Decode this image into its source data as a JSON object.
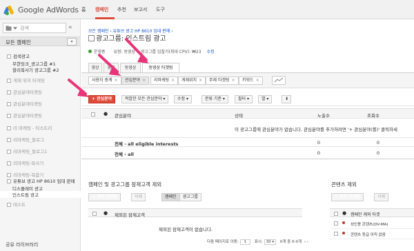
{
  "topbar": {
    "logo_text": "Google AdWords",
    "nav": [
      "홈",
      "캠페인",
      "추천",
      "보고서",
      "도구"
    ],
    "active_nav": "캠페인"
  },
  "sidebar": {
    "search_placeholder": "검색",
    "collapse_glyph": "«",
    "all_campaigns": "모든 캠페인",
    "items": [
      {
        "label": "검색광고",
        "style": "normal"
      },
      {
        "label": "무한잉크_광고그룹 #1",
        "style": "normal"
      },
      {
        "label": "할리복사기 광고그룹 #2",
        "style": "normal"
      },
      {
        "label": "게재 위치 타게팅",
        "style": "grey"
      },
      {
        "label": "관심분야타겟팅",
        "style": "grey"
      },
      {
        "label": "관심분야타겟팅",
        "style": "grey"
      },
      {
        "label": "관심분야타겟팅",
        "style": "grey"
      },
      {
        "label": "리 마케팅 - 타스트리",
        "style": "grey"
      },
      {
        "label": "리마케팅_블로그",
        "style": "grey"
      },
      {
        "label": "리마케팅_블로그1",
        "style": "grey"
      },
      {
        "label": "리마케팅-복사기",
        "style": "grey"
      },
      {
        "label": "리마케팅-복합기",
        "style": "grey"
      },
      {
        "label": "유튜브 광고 HP 8610 임대 판매",
        "style": "normal"
      },
      {
        "label": "디스플레이 광고",
        "style": "normal"
      },
      {
        "label": "인스트림 광고",
        "style": "selected"
      },
      {
        "label": "테스트",
        "style": "grey"
      }
    ],
    "footer": "공유 라이브러리"
  },
  "main": {
    "breadcrumb": "모든 캠페인 › 유튜브 광고 HP 8610 임대 판매 ›",
    "title": "광고그룹: 인스트림 광고",
    "status": {
      "state": "운영중",
      "type_label": "유형:",
      "type_value": "동영상",
      "bid_label": "광고그룹 입찰가(최대 CPV):",
      "bid_value": "₩23",
      "edit": "수정"
    },
    "tabs": [
      "영상",
      "광고",
      "동영상",
      "동영상 타겟팅"
    ],
    "active_tab": "동영상 타겟팅",
    "filters": [
      {
        "label": "사용자 층계",
        "active": false
      },
      {
        "label": "관심분야",
        "active": true
      },
      {
        "label": "리마케팅",
        "active": false
      },
      {
        "label": "게재위치",
        "active": false
      },
      {
        "label": "주제 타겟팅",
        "active": false
      },
      {
        "label": "키워드",
        "active": false
      }
    ],
    "toolbar": {
      "add_btn": "+ 관심분야",
      "bulk_btn": "적합한 모든 관심분야 ▾",
      "edit_btn": "수정 ▾",
      "segment_btn": "분류 기준 ▾",
      "filter_btn": "필터 ▾",
      "columns_btn": "열 ▾",
      "download_icon": "⬇"
    },
    "table": {
      "headers": [
        "관심분야",
        "상태",
        "노출수",
        "조회수"
      ],
      "empty_message": "이 광고그룹에 관심분야가 없습니다. 관심분야를 추가하려면 '+ 관심분야(를)' 클릭하세",
      "total_rows": [
        {
          "label": "전체 - all eligible interests",
          "impressions": "0",
          "views": "0"
        },
        {
          "label": "전체 - all",
          "impressions": "0",
          "views": "0"
        }
      ]
    },
    "exclusion_panel": {
      "title": "캠페인 및 광고그룹 잠재고객 제외",
      "add_btn": "+ 제외 타겟팅",
      "delete_btn": "삭제",
      "scope_campaign": "캠페인",
      "scope_adgroup": "광고그룹",
      "header": "제외된 잠재고객",
      "empty_message": "제외된 잠재고객이 없습니다.",
      "pagination": {
        "label": "다음 페이지로 이동:",
        "page": "1",
        "size_label": "표시:",
        "size": "30 ▾",
        "range": "0개 중 0-0개"
      }
    },
    "content_panel": {
      "title": "콘텐츠 제외",
      "add_btn": "+ 제외 타겟팅",
      "delete_btn": "삭제",
      "header": "캠페인 제외 타겟",
      "rows": [
        "성인용 콘텐츠(DV-MA)",
        "콘텐츠 등급 아직 없음"
      ]
    }
  },
  "colors": {
    "accent_red": "#dd4b39",
    "link_blue": "#1155cc",
    "annotation_pink": "#e8357a"
  }
}
